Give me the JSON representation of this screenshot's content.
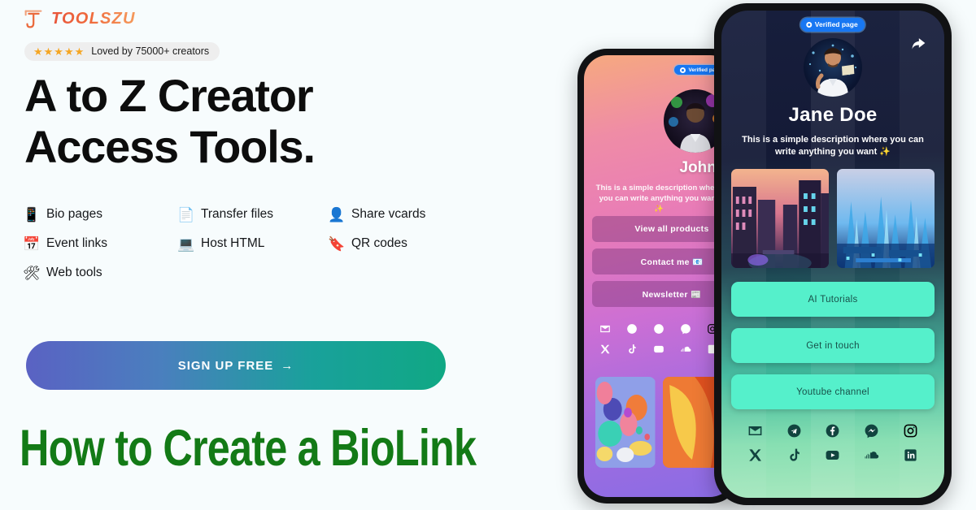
{
  "brand": {
    "name": "TOOLSZU",
    "logo_icon": "toolszu-t-logo",
    "accent": "#ef6a3c"
  },
  "rating": {
    "stars": "★★★★★",
    "text": "Loved by 75000+ creators",
    "star_color": "#f5a623"
  },
  "headline": {
    "line1": "A to Z Creator",
    "line2": "Access Tools."
  },
  "features": [
    {
      "icon": "📱",
      "label": "Bio pages",
      "icon_name": "mobile-phone-icon"
    },
    {
      "icon": "📄",
      "label": "Transfer files",
      "icon_name": "document-icon"
    },
    {
      "icon": "👤",
      "label": "Share vcards",
      "icon_name": "person-icon"
    },
    {
      "icon": "📅",
      "label": "Event links",
      "icon_name": "calendar-icon"
    },
    {
      "icon": "💻",
      "label": "Host HTML",
      "icon_name": "laptop-icon"
    },
    {
      "icon": "🔖",
      "label": "QR codes",
      "icon_name": "qr-code-icon"
    },
    {
      "icon": "🛠",
      "label": "Web tools",
      "icon_name": "tools-icon"
    }
  ],
  "cta": {
    "label": "SIGN UP FREE",
    "arrow": "→",
    "gradient_from": "#5a62c3",
    "gradient_to": "#10a884"
  },
  "bottom_title": {
    "text": "How to Create a BioLink",
    "color": "#137a16"
  },
  "phone_left": {
    "verified_badge": "Verified page",
    "profile_name": "John Doe",
    "description": "This is a simple description where you can write anything you want ✨",
    "buttons": [
      "View all products",
      "Contact me 📧",
      "Newsletter 📰"
    ],
    "socials_row1": [
      "email",
      "telegram",
      "facebook",
      "messenger",
      "instagram"
    ],
    "socials_row2": [
      "x",
      "tiktok",
      "youtube",
      "soundcloud",
      "linkedin"
    ]
  },
  "phone_right": {
    "verified_badge": "Verified page",
    "share_icon": "share-arrow-icon",
    "profile_name": "Jane Doe",
    "description": "This is a simple description where you can write anything you want ✨",
    "gallery": [
      "cyberpunk-city-sunset",
      "blue-crystal-city"
    ],
    "buttons": [
      "AI Tutorials",
      "Get in touch",
      "Youtube channel"
    ],
    "socials_row1": [
      "email",
      "telegram",
      "facebook",
      "messenger",
      "instagram"
    ],
    "socials_row2": [
      "x",
      "tiktok",
      "youtube",
      "soundcloud",
      "linkedin"
    ],
    "button_color": "#55f0cb"
  }
}
